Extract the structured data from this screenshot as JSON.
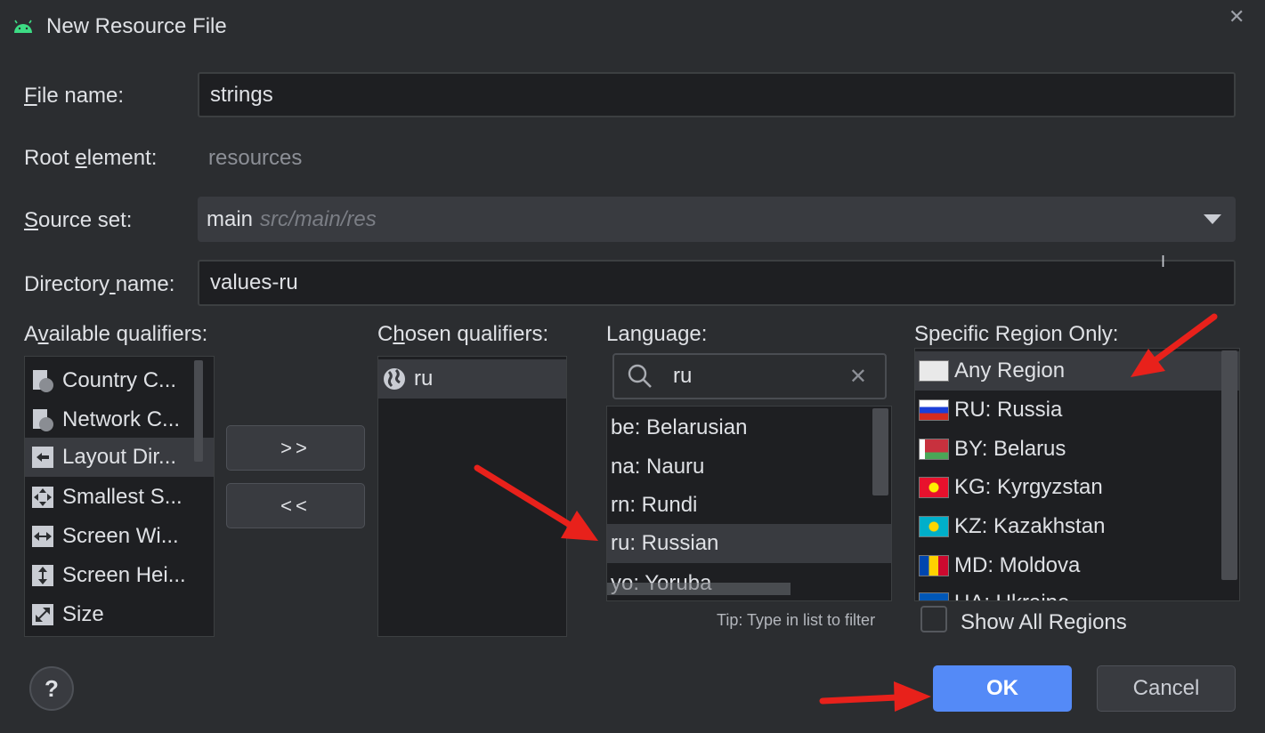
{
  "dialog": {
    "title": "New Resource File",
    "close_glyph": "✕"
  },
  "form": {
    "file_name": {
      "label_prefix": "",
      "label_u": "F",
      "label_rest": "ile name:",
      "value": "strings"
    },
    "root_element": {
      "label_prefix": "Root ",
      "label_u": "e",
      "label_rest": "lement:",
      "value": "resources"
    },
    "source_set": {
      "label_prefix": "",
      "label_u": "S",
      "label_rest": "ource set:",
      "value": "main",
      "hint": "src/main/res"
    },
    "directory_name": {
      "label_prefix": "Directory",
      "label_u": " ",
      "label_rest": "name:",
      "value": "values-ru"
    }
  },
  "available": {
    "label_prefix": "A",
    "label_u": "v",
    "label_rest": "ailable qualifiers:",
    "items": [
      {
        "label": "Country C...",
        "icon": "country-code-icon"
      },
      {
        "label": "Network C...",
        "icon": "network-code-icon"
      },
      {
        "label": "Layout Dir...",
        "icon": "layout-direction-icon",
        "selected": true
      },
      {
        "label": "Smallest S...",
        "icon": "smallest-screen-width-icon"
      },
      {
        "label": "Screen Wi...",
        "icon": "screen-width-icon"
      },
      {
        "label": "Screen Hei...",
        "icon": "screen-height-icon"
      },
      {
        "label": "Size",
        "icon": "size-icon"
      }
    ]
  },
  "buttons": {
    "add": ">>",
    "remove": "<<",
    "ok": "OK",
    "cancel": "Cancel",
    "help": "?"
  },
  "chosen": {
    "label_prefix": "C",
    "label_u": "h",
    "label_rest": "osen qualifiers:",
    "items": [
      {
        "label": "ru",
        "icon": "globe-icon"
      }
    ]
  },
  "language": {
    "label": "Language:",
    "search_value": "ru",
    "items": [
      "be: Belarusian",
      "na: Nauru",
      "rn: Rundi",
      "ru: Russian",
      "yo: Yoruba"
    ],
    "selected_index": 3,
    "tip": "Tip: Type in list to filter"
  },
  "region": {
    "label": "Specific Region Only:",
    "items": [
      {
        "label": "Any Region",
        "flag": "any-region-flag-icon"
      },
      {
        "label": "RU: Russia",
        "flag": "russia-flag-icon"
      },
      {
        "label": "BY: Belarus",
        "flag": "belarus-flag-icon"
      },
      {
        "label": "KG: Kyrgyzstan",
        "flag": "kyrgyzstan-flag-icon"
      },
      {
        "label": "KZ: Kazakhstan",
        "flag": "kazakhstan-flag-icon"
      },
      {
        "label": "MD: Moldova",
        "flag": "moldova-flag-icon"
      },
      {
        "label": "UA: Ukraine",
        "flag": "ukraine-flag-icon"
      }
    ],
    "selected_index": 0,
    "show_all_label": "Show All Regions",
    "show_all_checked": false
  },
  "colors": {
    "accent": "#548af7",
    "background": "#2b2d30",
    "annotation_arrow": "#e8211b"
  }
}
